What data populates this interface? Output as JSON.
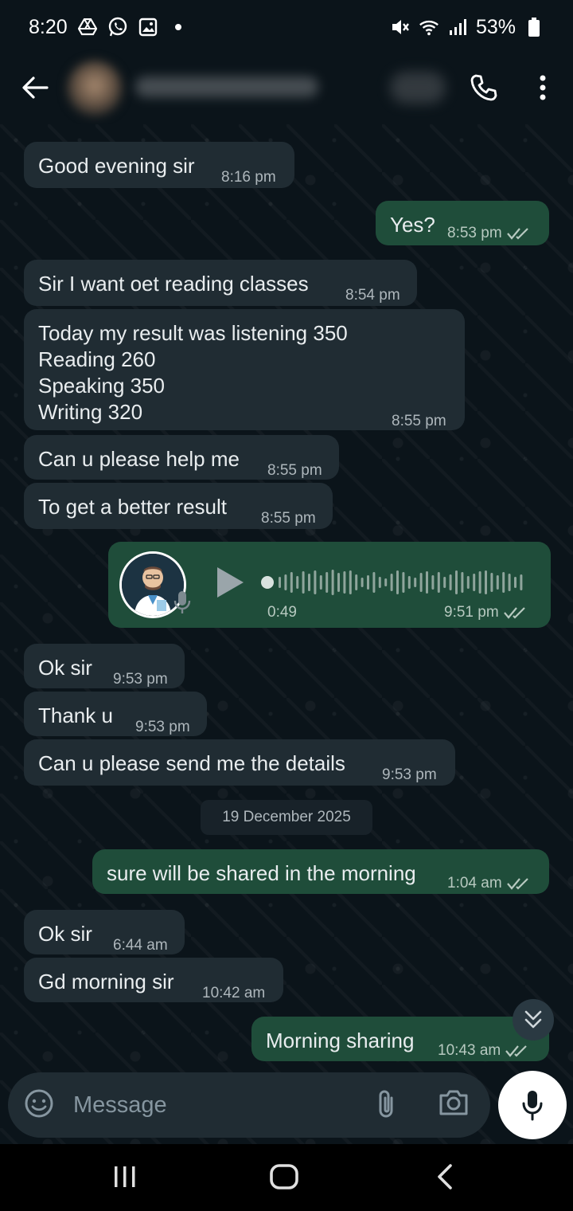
{
  "status_bar": {
    "time": "8:20",
    "battery": "53%"
  },
  "messages": [
    {
      "dir": "in",
      "text": "Good evening sir",
      "time": "8:16 pm"
    },
    {
      "dir": "out",
      "text": "Yes?",
      "time": "8:53 pm",
      "status": "read"
    },
    {
      "dir": "in",
      "text": "Sir I want oet reading classes",
      "time": "8:54 pm"
    },
    {
      "dir": "in",
      "text": "Today my result was listening 350\nReading 260\nSpeaking 350\nWriting 320",
      "time": "8:55 pm"
    },
    {
      "dir": "in",
      "text": "Can u please help me",
      "time": "8:55 pm"
    },
    {
      "dir": "in",
      "text": "To get a better result",
      "time": "8:55 pm"
    },
    {
      "dir": "in",
      "text": "Ok sir",
      "time": "9:53 pm"
    },
    {
      "dir": "in",
      "text": "Thank u",
      "time": "9:53 pm"
    },
    {
      "dir": "in",
      "text": "Can u please send me the details",
      "time": "9:53 pm"
    },
    {
      "dir": "out",
      "text": "sure will be shared in the morning",
      "time": "1:04 am",
      "status": "read"
    },
    {
      "dir": "in",
      "text": "Ok sir",
      "time": "6:44 am"
    },
    {
      "dir": "in",
      "text": "Gd morning sir",
      "time": "10:42 am"
    },
    {
      "dir": "out",
      "text": "Morning sharing",
      "time": "10:43 am",
      "status": "read"
    }
  ],
  "voice_message": {
    "duration": "0:49",
    "time": "9:51 pm",
    "status": "read",
    "progress": 0
  },
  "date_separator": "19 December 2025",
  "composer": {
    "placeholder": "Message"
  },
  "colors": {
    "background": "#0b141a",
    "incoming_bubble": "#202c33",
    "outgoing_bubble": "#1f4d3a",
    "read_ticks": "#b7c9c0"
  }
}
